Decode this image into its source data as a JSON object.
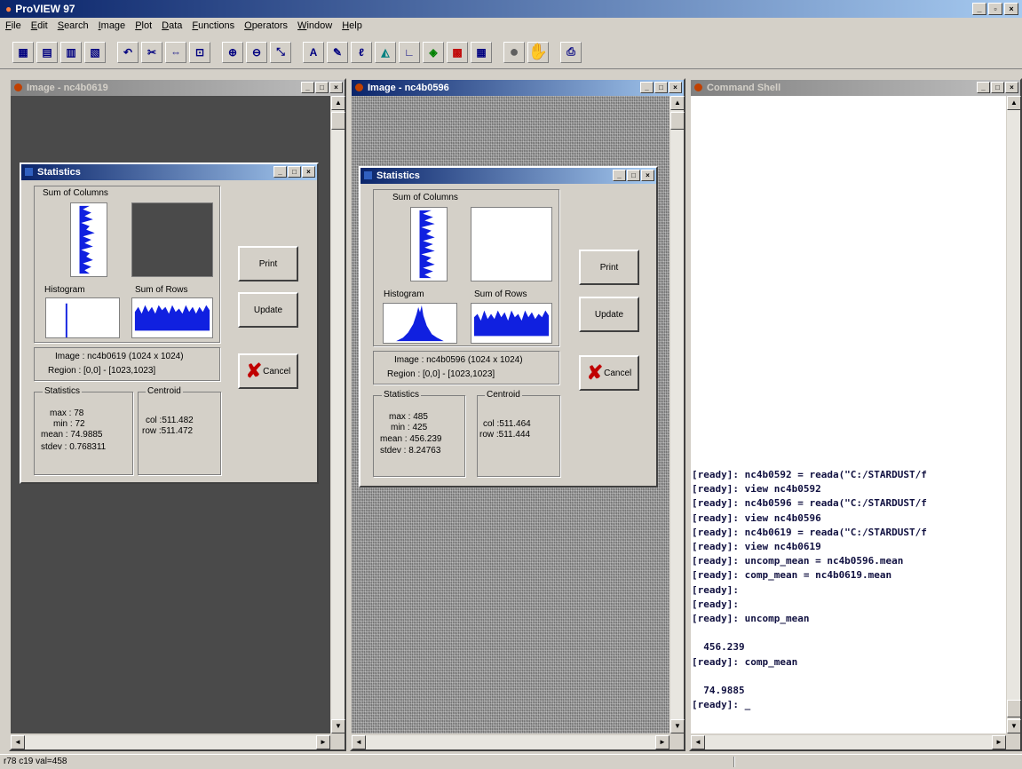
{
  "app": {
    "title": "ProVIEW 97",
    "controls": [
      "_",
      "▫",
      "×"
    ]
  },
  "menu": [
    "File",
    "Edit",
    "Search",
    "Image",
    "Plot",
    "Data",
    "Functions",
    "Operators",
    "Window",
    "Help"
  ],
  "windows": {
    "left": {
      "title": "Image - nc4b0619"
    },
    "middle": {
      "title": "Image - nc4b0596"
    },
    "shell": {
      "title": "Command Shell"
    }
  },
  "stats_left": {
    "title": "Statistics",
    "sum_cols_label": "Sum of Columns",
    "histogram_label": "Histogram",
    "sum_rows_label": "Sum of Rows",
    "image_line": "Image : nc4b0619 (1024 x 1024)",
    "region_line": "Region : [0,0] - [1023,1023]",
    "stats_group": "Statistics",
    "centroid_group": "Centroid",
    "max": "max : 78",
    "min": "min : 72",
    "mean": "mean : 74.9885",
    "stdev": "stdev : 0.768311",
    "col": "col :511.482",
    "row": "row :511.472",
    "print": "Print",
    "update": "Update",
    "cancel": "Cancel"
  },
  "stats_mid": {
    "title": "Statistics",
    "sum_cols_label": "Sum of Columns",
    "histogram_label": "Histogram",
    "sum_rows_label": "Sum of Rows",
    "image_line": "Image : nc4b0596 (1024 x 1024)",
    "region_line": "Region : [0,0] - [1023,1023]",
    "stats_group": "Statistics",
    "centroid_group": "Centroid",
    "max": "max : 485",
    "min": "min : 425",
    "mean": "mean : 456.239",
    "stdev": "stdev : 8.24763",
    "col": "col :511.464",
    "row": "row :511.444",
    "print": "Print",
    "update": "Update",
    "cancel": "Cancel"
  },
  "console": [
    "[ready]: nc4b0592 = reada(\"C:/STARDUST/f",
    "[ready]: view nc4b0592",
    "[ready]: nc4b0596 = reada(\"C:/STARDUST/f",
    "[ready]: view nc4b0596",
    "[ready]: nc4b0619 = reada(\"C:/STARDUST/f",
    "[ready]: view nc4b0619",
    "[ready]: uncomp_mean = nc4b0596.mean",
    "[ready]: comp_mean = nc4b0619.mean",
    "[ready]:",
    "[ready]:",
    "[ready]: uncomp_mean",
    "",
    "  456.239",
    "[ready]: comp_mean",
    "",
    "  74.9885",
    "[ready]: _"
  ],
  "status": "r78 c19 val=458"
}
